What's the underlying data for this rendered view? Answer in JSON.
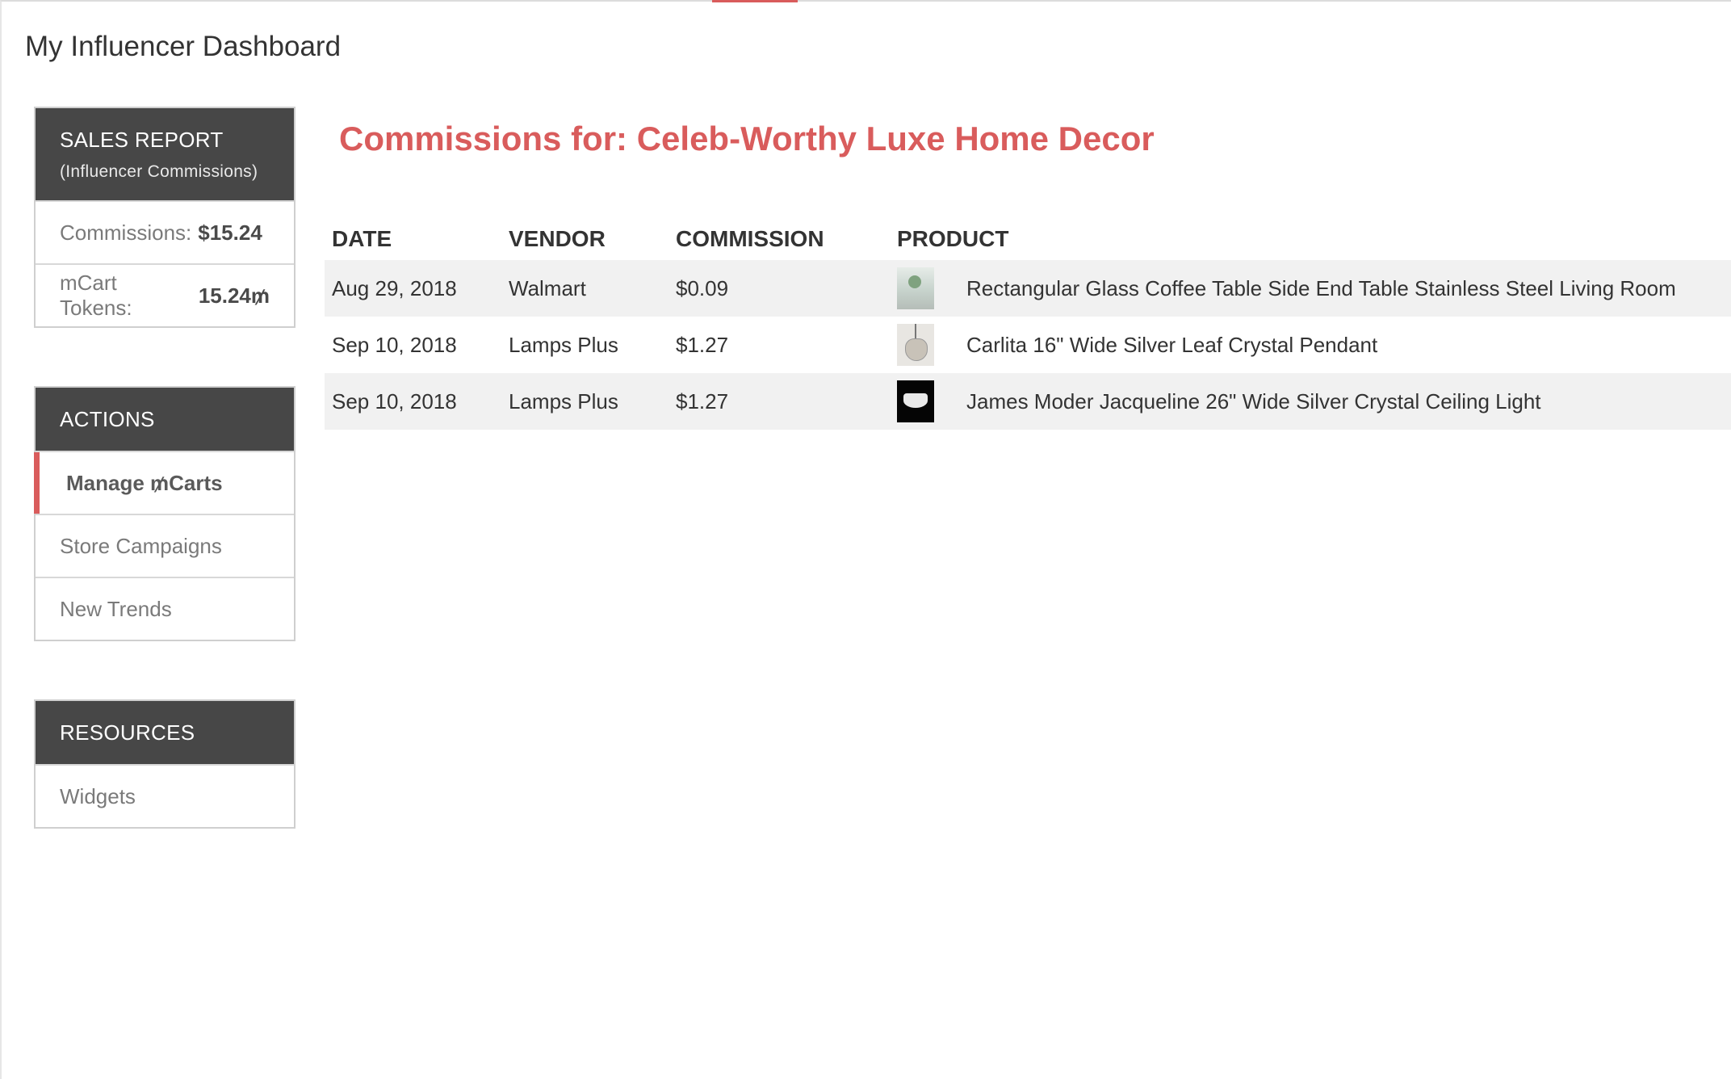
{
  "header": {
    "title": "My Influencer Dashboard"
  },
  "sidebar": {
    "sales_report": {
      "title": "SALES REPORT",
      "subtitle": "(Influencer Commissions)",
      "commissions_label": "Commissions:",
      "commissions_value": "$15.24",
      "tokens_label": "mCart Tokens:",
      "tokens_value": "15.24₥"
    },
    "actions": {
      "title": "ACTIONS",
      "items": [
        {
          "label": "Manage ₥Carts",
          "active": true
        },
        {
          "label": "Store Campaigns"
        },
        {
          "label": "New Trends"
        }
      ]
    },
    "resources": {
      "title": "RESOURCES",
      "items": [
        {
          "label": "Widgets"
        }
      ]
    }
  },
  "main": {
    "title": "Commissions for: Celeb-Worthy Luxe Home Decor",
    "table": {
      "columns": [
        "DATE",
        "VENDOR",
        "COMMISSION",
        "PRODUCT"
      ],
      "rows": [
        {
          "date": "Aug 29, 2018",
          "vendor": "Walmart",
          "commission": "$0.09",
          "product": "Rectangular Glass Coffee Table Side End Table Stainless Steel Living Room",
          "thumb": "glass-table-thumbnail"
        },
        {
          "date": "Sep 10, 2018",
          "vendor": "Lamps Plus",
          "commission": "$1.27",
          "product": "Carlita 16\" Wide Silver Leaf Crystal Pendant",
          "thumb": "pendant-thumbnail"
        },
        {
          "date": "Sep 10, 2018",
          "vendor": "Lamps Plus",
          "commission": "$1.27",
          "product": "James Moder Jacqueline 26\" Wide Silver Crystal Ceiling Light",
          "thumb": "ceiling-light-thumbnail"
        }
      ]
    }
  },
  "colors": {
    "accent": "#d95c5c",
    "panel_header": "#474747",
    "row_alt": "#f1f1f1"
  }
}
